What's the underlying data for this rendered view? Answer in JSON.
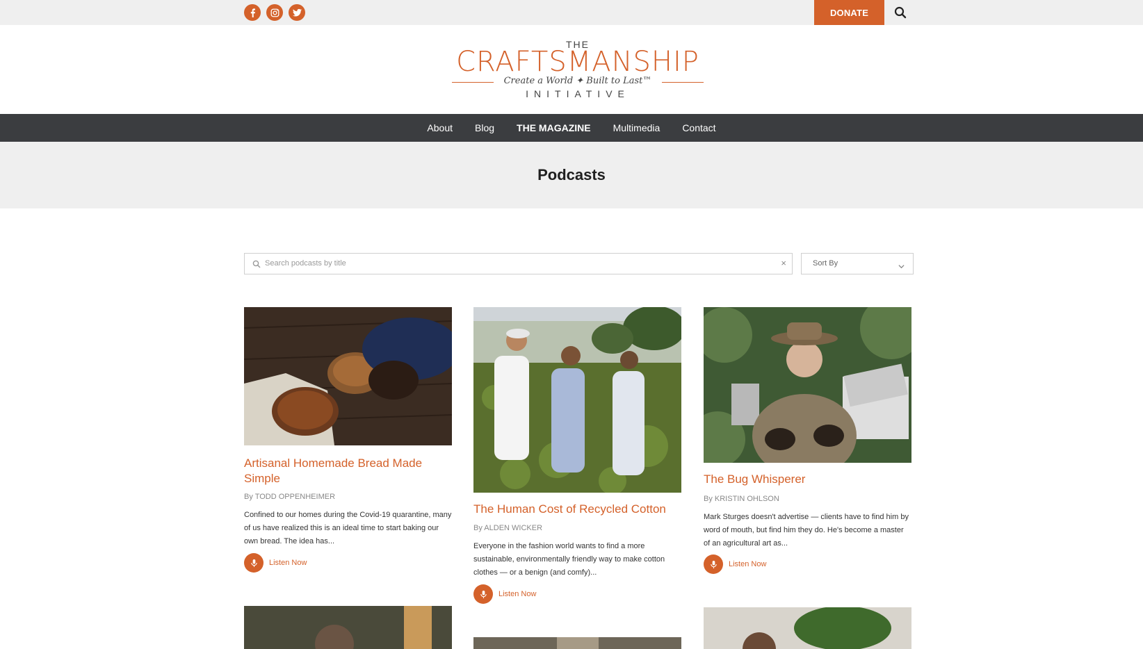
{
  "topbar": {
    "social": [
      {
        "icon": "facebook-icon",
        "label": "f"
      },
      {
        "icon": "instagram-icon",
        "label": ""
      },
      {
        "icon": "twitter-icon",
        "label": ""
      }
    ],
    "donate_label": "DONATE"
  },
  "logo": {
    "the": "THE",
    "main": "CRAFTSMANSHIP",
    "tagline": "Create a World ✦ Built to Last™",
    "initiative": "INITIATIVE"
  },
  "nav": {
    "items": [
      "About",
      "Blog",
      "THE MAGAZINE",
      "Multimedia",
      "Contact"
    ]
  },
  "page": {
    "title": "Podcasts"
  },
  "search": {
    "placeholder": "Search podcasts by title",
    "clear": "×",
    "sort_label": "Sort By"
  },
  "cards": [
    {
      "title": "Artisanal Homemade Bread Made Simple",
      "by": "By",
      "author": "TODD OPPENHEIMER",
      "desc": "Confined to our homes during the Covid-19 quarantine, many of us have realized this is an ideal time to start baking our own bread. The idea has...",
      "listen": "Listen Now"
    },
    {
      "title": "The Human Cost of Recycled Cotton",
      "by": "By",
      "author": "ALDEN WICKER",
      "desc": "Everyone in the fashion world wants to find a more sustainable, environmentally friendly way to make cotton clothes — or a benign (and comfy)...",
      "listen": "Listen Now"
    },
    {
      "title": "The Bug Whisperer",
      "by": "By",
      "author": "KRISTIN OHLSON",
      "desc": "Mark Sturges doesn't advertise — clients have to find him by word of mouth, but find him they do. He's become a master of an agricultural art as...",
      "listen": "Listen Now"
    }
  ],
  "colors": {
    "accent": "#d4612a",
    "nav_bg": "#3b3d40",
    "banner_bg": "#efefef"
  }
}
